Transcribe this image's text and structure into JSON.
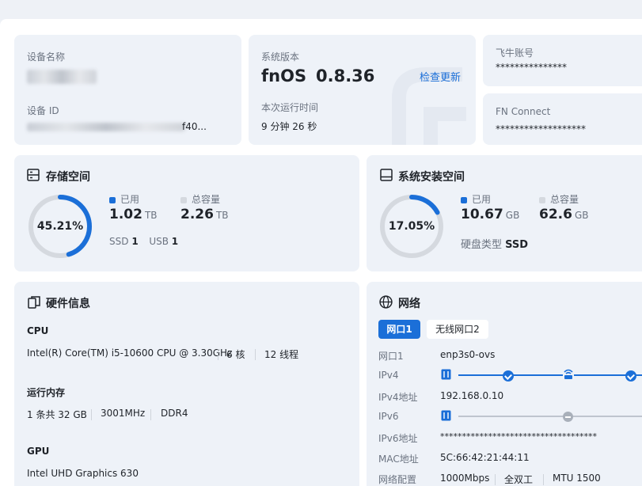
{
  "device": {
    "name_label": "设备名称",
    "id_label": "设备 ID",
    "id_value_tail": "f40..."
  },
  "system": {
    "version_label": "系统版本",
    "os_name": "fnOS",
    "os_version": "0.8.36",
    "check_update": "检查更新",
    "uptime_label": "本次运行时间",
    "uptime_value": "9 分钟 26 秒"
  },
  "account": {
    "label": "飞牛账号",
    "value": "***************"
  },
  "fn_connect": {
    "label": "FN Connect",
    "value": "*******************"
  },
  "storage": {
    "title": "存储空间",
    "percent_text": "45.21%",
    "percent": 45.21,
    "used_label": "已用",
    "used_value": "1.02",
    "used_unit": "TB",
    "total_label": "总容量",
    "total_value": "2.26",
    "total_unit": "TB",
    "ssd_label": "SSD",
    "ssd_count": "1",
    "usb_label": "USB",
    "usb_count": "1"
  },
  "sys_space": {
    "title": "系统安装空间",
    "percent_text": "17.05%",
    "percent": 17.05,
    "used_label": "已用",
    "used_value": "10.67",
    "used_unit": "GB",
    "total_label": "总容量",
    "total_value": "62.6",
    "total_unit": "GB",
    "disk_type_label": "硬盘类型",
    "disk_type_value": "SSD"
  },
  "hardware": {
    "title": "硬件信息",
    "cpu_label": "CPU",
    "cpu_model": "Intel(R) Core(TM) i5-10600 CPU @ 3.30GHz",
    "cpu_cores": "6 核",
    "cpu_threads": "12 线程",
    "mem_label": "运行内存",
    "mem_sticks": "1 条共 32 GB",
    "mem_freq": "3001MHz",
    "mem_type": "DDR4",
    "gpu_label": "GPU",
    "gpu_model": "Intel UHD Graphics 630"
  },
  "network": {
    "title": "网络",
    "tab1": "网口1",
    "tab2": "无线网口2",
    "port_label": "网口1",
    "port_value": "enp3s0-ovs",
    "ipv4_label": "IPv4",
    "ipv4_addr_label": "IPv4地址",
    "ipv4_addr_value": "192.168.0.10",
    "ipv6_label": "IPv6",
    "ipv6_addr_label": "IPv6地址",
    "ipv6_addr_value": "************************************",
    "mac_label": "MAC地址",
    "mac_value": "5C:66:42:21:44:11",
    "config_label": "网络配置",
    "speed": "1000Mbps",
    "duplex": "全双工",
    "mtu": "MTU 1500"
  },
  "colors": {
    "accent": "#1b6fd8",
    "ring_bg": "#d5d9df",
    "card_bg": "#eef2f8"
  }
}
